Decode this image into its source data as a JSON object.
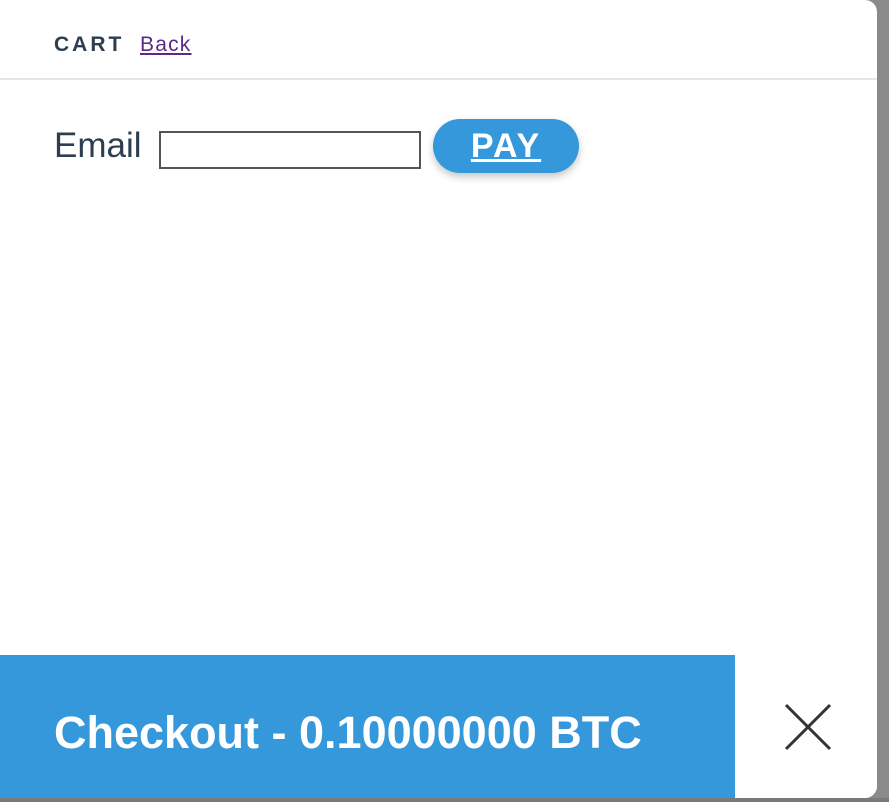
{
  "header": {
    "title": "CART",
    "back_label": "Back"
  },
  "form": {
    "email_label": "Email",
    "email_value": "",
    "email_placeholder": "",
    "pay_label": "PAY"
  },
  "footer": {
    "checkout_label": "Checkout - 0.10000000 BTC",
    "close_icon": "close-icon"
  },
  "colors": {
    "accent": "#3498db",
    "text": "#2c3e50",
    "link_visited": "#5a2a86"
  }
}
